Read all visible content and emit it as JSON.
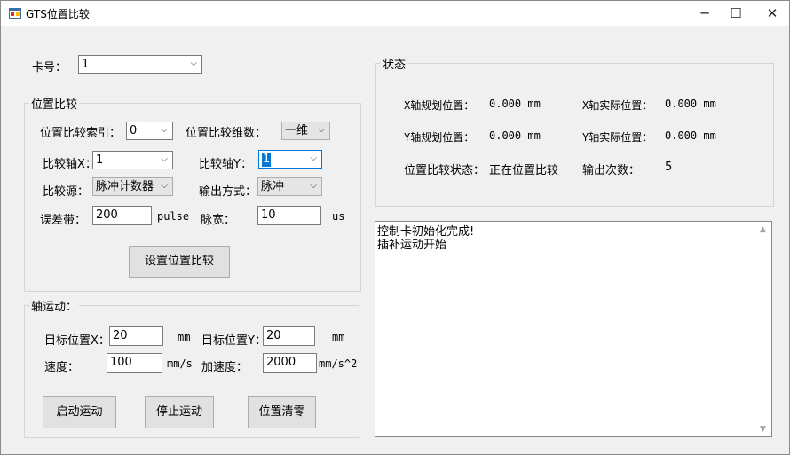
{
  "window": {
    "title": "GTS位置比较",
    "min": "─",
    "max": "☐",
    "close": "✕"
  },
  "card": {
    "label": "卡号：",
    "value": "1"
  },
  "compare": {
    "title": "位置比较",
    "index_label": "位置比较索引：",
    "index_value": "0",
    "dim_label": "位置比较维数：",
    "dim_value": "一维",
    "axis_x_label": "比较轴X：",
    "axis_x_value": "1",
    "axis_y_label": "比较轴Y：",
    "axis_y_value": "1",
    "source_label": "比较源：",
    "source_value": "脉冲计数器",
    "output_label": "输出方式：",
    "output_value": "脉冲",
    "error_label": "误差带：",
    "error_value": "200",
    "error_unit": "pulse",
    "width_label": "脉宽：",
    "width_value": "10",
    "width_unit": "us",
    "set_button": "设置位置比较"
  },
  "motion": {
    "title": "轴运动：",
    "target_x_label": "目标位置X：",
    "target_x_value": "20",
    "target_x_unit": "mm",
    "target_y_label": "目标位置Y：",
    "target_y_value": "20",
    "target_y_unit": "mm",
    "speed_label": "速度：",
    "speed_value": "100",
    "speed_unit": "mm/s",
    "acc_label": "加速度：",
    "acc_value": "2000",
    "acc_unit": "mm/s^2",
    "start_button": "启动运动",
    "stop_button": "停止运动",
    "zero_button": "位置清零"
  },
  "status": {
    "title": "状态",
    "x_plan_label": "X轴规划位置：",
    "x_plan_value": "0.000 mm",
    "x_actual_label": "X轴实际位置：",
    "x_actual_value": "0.000 mm",
    "y_plan_label": "Y轴规划位置：",
    "y_plan_value": "0.000 mm",
    "y_actual_label": "Y轴实际位置：",
    "y_actual_value": "0.000 mm",
    "cmp_state_label": "位置比较状态：",
    "cmp_state_value": "正在位置比较",
    "out_count_label": "输出次数：",
    "out_count_value": "5"
  },
  "log": {
    "lines": [
      "控制卡初始化完成!",
      "插补运动开始"
    ]
  },
  "icons": {
    "dropdown": "chevron-down-icon",
    "scroll_up": "scroll-up-icon",
    "scroll_down": "scroll-down-icon"
  }
}
